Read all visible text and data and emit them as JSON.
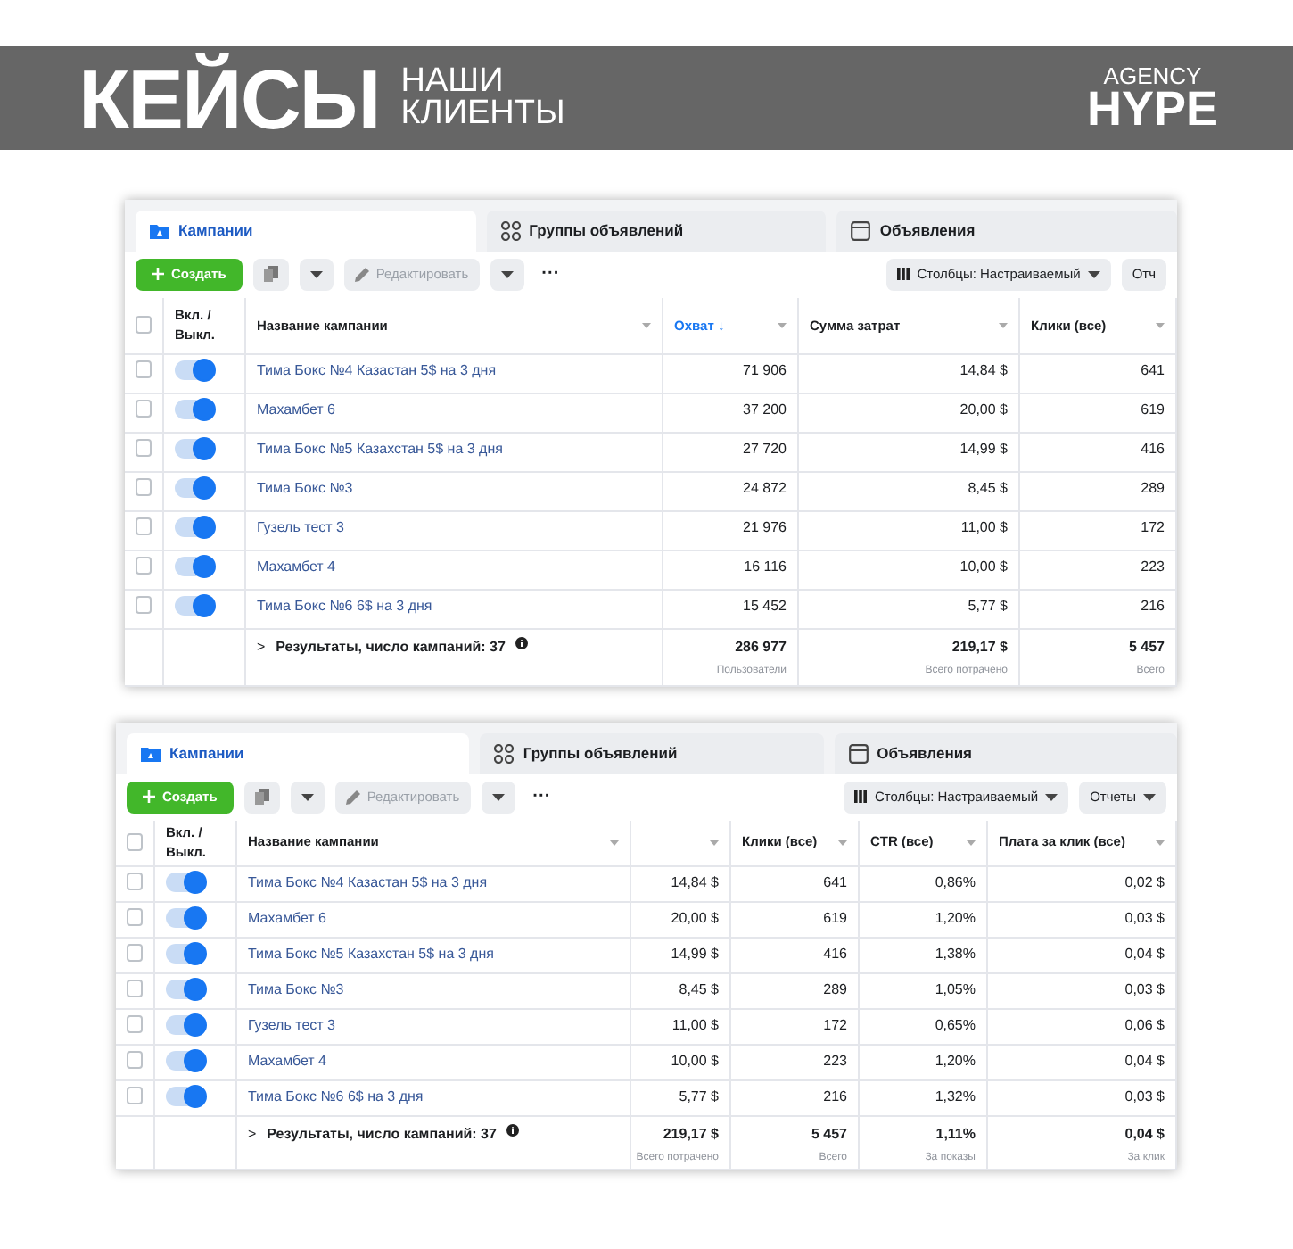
{
  "banner": {
    "title": "КЕЙСЫ",
    "subtitle": [
      "НАШИ",
      "КЛИЕНТЫ"
    ],
    "logo": {
      "top": "AGENCY",
      "bottom": "HYPE"
    }
  },
  "panels": [
    {
      "tabs": [
        {
          "label": "Кампании",
          "selected": true
        },
        {
          "label": "Группы объявлений",
          "selected": false
        },
        {
          "label": "Объявления",
          "selected": false
        }
      ],
      "toolbar": {
        "create": "Создать",
        "edit": {
          "label": "Редактировать",
          "disabled": true
        },
        "more": "···",
        "columns": "Столбцы: Настраиваемый",
        "reports": {
          "label": "Отч",
          "caret": false
        }
      },
      "select_all_checked": false,
      "columns": [
        {
          "label": "Вкл. / Выкл."
        },
        {
          "label": "Название кампании"
        },
        {
          "label": "Охват",
          "sorted": true,
          "sort_arrow": "↓"
        },
        {
          "label": "Сумма затрат"
        },
        {
          "label": "Клики (все)"
        }
      ],
      "rows": [
        {
          "checked": false,
          "on": true,
          "name": "Тима Бокс №4 Казастан 5$ на 3 дня",
          "values": [
            "71 906",
            "14,84 $",
            "641"
          ]
        },
        {
          "checked": false,
          "on": true,
          "name": "Махамбет 6",
          "values": [
            "37 200",
            "20,00 $",
            "619"
          ]
        },
        {
          "checked": false,
          "on": true,
          "name": "Тима Бокс №5 Казахстан 5$ на 3 дня",
          "values": [
            "27 720",
            "14,99 $",
            "416"
          ]
        },
        {
          "checked": false,
          "on": true,
          "name": "Тима Бокс №3",
          "values": [
            "24 872",
            "8,45 $",
            "289"
          ]
        },
        {
          "checked": false,
          "on": true,
          "name": "Гузель тест 3",
          "values": [
            "21 976",
            "11,00 $",
            "172"
          ]
        },
        {
          "checked": false,
          "on": true,
          "name": "Махамбет 4",
          "values": [
            "16 116",
            "10,00 $",
            "223"
          ]
        },
        {
          "checked": false,
          "on": true,
          "name": "Тима Бокс №6 6$ на 3 дня",
          "values": [
            "15 452",
            "5,77 $",
            "216"
          ]
        }
      ],
      "totals": {
        "chevron": ">",
        "label": "Результаты, число кампаний: 37",
        "values": [
          {
            "value": "286 977",
            "note": "Пользователи"
          },
          {
            "value": "219,17 $",
            "note": "Всего потрачено"
          },
          {
            "value": "5 457",
            "note": "Всего"
          }
        ]
      }
    },
    {
      "tabs": [
        {
          "label": "Кампании",
          "selected": true
        },
        {
          "label": "Группы объявлений",
          "selected": false
        },
        {
          "label": "Объявления",
          "selected": false
        }
      ],
      "toolbar": {
        "create": "Создать",
        "edit": {
          "label": "Редактировать",
          "disabled": true
        },
        "more": "···",
        "columns": "Столбцы: Настраиваемый",
        "reports": {
          "label": "Отчеты",
          "caret": true
        }
      },
      "select_all_checked": false,
      "columns": [
        {
          "label": "Вкл. / Выкл."
        },
        {
          "label": "Название кампании"
        },
        {},
        {
          "label": "Клики (все)"
        },
        {
          "label": "CTR (все)"
        },
        {
          "label": "Плата за клик (все)"
        }
      ],
      "rows": [
        {
          "checked": false,
          "on": true,
          "name": "Тима Бокс №4 Казастан 5$ на 3 дня",
          "values": [
            "14,84 $",
            "641",
            "0,86%",
            "0,02 $"
          ]
        },
        {
          "checked": false,
          "on": true,
          "name": "Махамбет 6",
          "values": [
            "20,00 $",
            "619",
            "1,20%",
            "0,03 $"
          ]
        },
        {
          "checked": false,
          "on": true,
          "name": "Тима Бокс №5 Казахстан 5$ на 3 дня",
          "values": [
            "14,99 $",
            "416",
            "1,38%",
            "0,04 $"
          ]
        },
        {
          "checked": false,
          "on": true,
          "name": "Тима Бокс №3",
          "values": [
            "8,45 $",
            "289",
            "1,05%",
            "0,03 $"
          ]
        },
        {
          "checked": false,
          "on": true,
          "name": "Гузель тест 3",
          "values": [
            "11,00 $",
            "172",
            "0,65%",
            "0,06 $"
          ]
        },
        {
          "checked": false,
          "on": true,
          "name": "Махамбет 4",
          "values": [
            "10,00 $",
            "223",
            "1,20%",
            "0,04 $"
          ]
        },
        {
          "checked": false,
          "on": true,
          "name": "Тима Бокс №6 6$ на 3 дня",
          "values": [
            "5,77 $",
            "216",
            "1,32%",
            "0,03 $"
          ]
        }
      ],
      "totals": {
        "chevron": ">",
        "label": "Результаты, число кампаний: 37",
        "values": [
          {
            "value": "219,17 $",
            "note": "Всего потрачено"
          },
          {
            "value": "5 457",
            "note": "Всего"
          },
          {
            "value": "1,11%",
            "note": "За показы"
          },
          {
            "value": "0,04 $",
            "note": "За клик"
          }
        ]
      }
    }
  ]
}
